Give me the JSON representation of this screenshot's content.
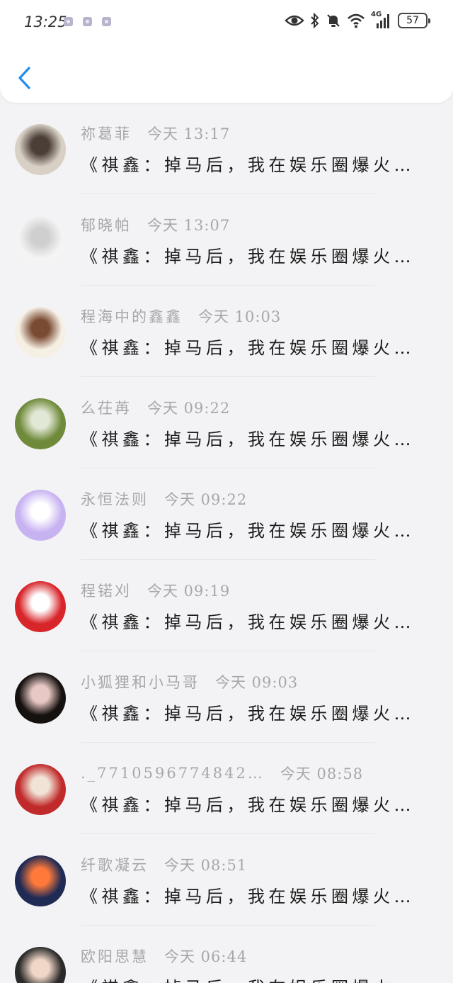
{
  "status": {
    "time": "13:25",
    "battery": "57",
    "network": "4G"
  },
  "nav": {
    "back_icon": "chevron-left-icon"
  },
  "accent": "#1e8cf0",
  "comments": [
    {
      "name": "祢葛菲",
      "time": "今天 13:17",
      "message": "《祺鑫：掉马后，我在娱乐圈爆火…",
      "avatar_colors": [
        "#d9d0c5",
        "#4a3e36"
      ]
    },
    {
      "name": "郁晓帕",
      "time": "今天 13:07",
      "message": "《祺鑫：掉马后，我在娱乐圈爆火…",
      "avatar_colors": [
        "#f4f4f4",
        "#cfcfcf"
      ]
    },
    {
      "name": "程海中的鑫鑫",
      "time": "今天 10:03",
      "message": "《祺鑫：掉马后，我在娱乐圈爆火…",
      "avatar_colors": [
        "#f6efe4",
        "#7a4b33"
      ]
    },
    {
      "name": "么茌苒",
      "time": "今天 09:22",
      "message": "《祺鑫：掉马后，我在娱乐圈爆火…",
      "avatar_colors": [
        "#6f8a3a",
        "#e2e8d6"
      ]
    },
    {
      "name": "永恒法则",
      "time": "今天 09:22",
      "message": "《祺鑫：掉马后，我在娱乐圈爆火…",
      "avatar_colors": [
        "#c7b3f2",
        "#ffffff"
      ]
    },
    {
      "name": "程锘刈",
      "time": "今天 09:19",
      "message": "《祺鑫：掉马后，我在娱乐圈爆火…",
      "avatar_colors": [
        "#d8252a",
        "#ffffff"
      ]
    },
    {
      "name": "小狐狸和小马哥",
      "time": "今天 09:03",
      "message": "《祺鑫：掉马后，我在娱乐圈爆火…",
      "avatar_colors": [
        "#15110f",
        "#e8c8c4"
      ]
    },
    {
      "name": "._7710596774842…",
      "time": "今天 08:58",
      "message": "《祺鑫：掉马后，我在娱乐圈爆火…",
      "avatar_colors": [
        "#c02a2a",
        "#f1e3d6"
      ]
    },
    {
      "name": "纤歌凝云",
      "time": "今天 08:51",
      "message": "《祺鑫：掉马后，我在娱乐圈爆火…",
      "avatar_colors": [
        "#1f2a55",
        "#ff7a3a"
      ]
    },
    {
      "name": "欧阳思慧",
      "time": "今天 06:44",
      "message": "《祺鑫：掉马后，我在娱乐圈爆火…",
      "avatar_colors": [
        "#2a2a2a",
        "#f1d7c8"
      ]
    }
  ]
}
